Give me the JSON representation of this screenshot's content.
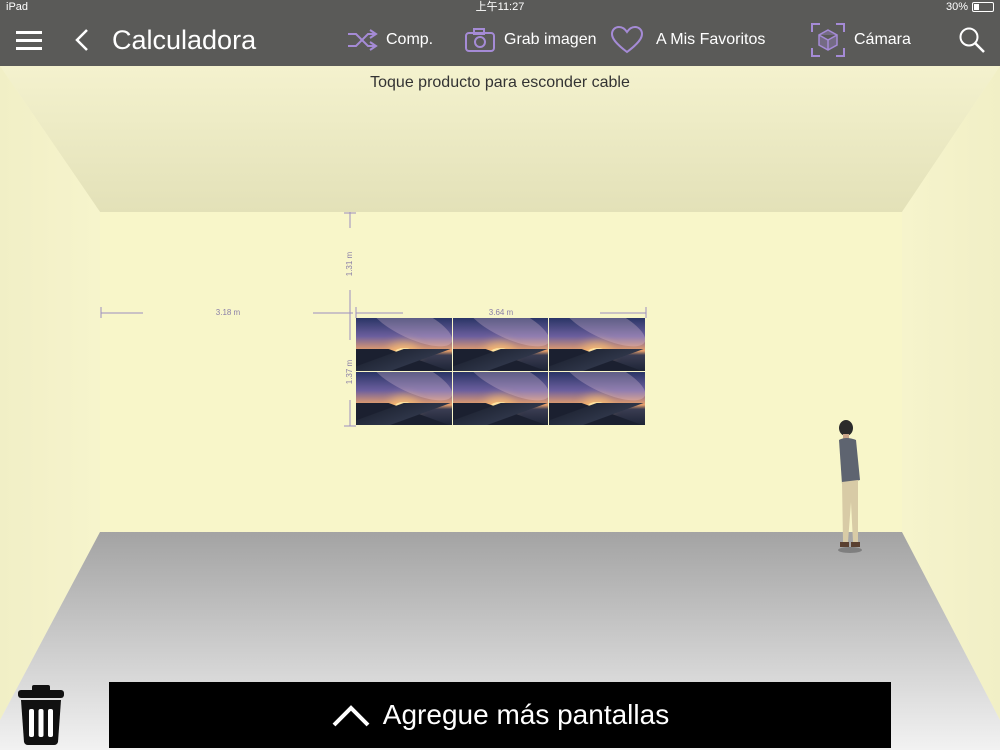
{
  "status_bar": {
    "device": "iPad",
    "time": "上午11:27",
    "battery": "30%",
    "battery_level": 0.3
  },
  "nav": {
    "title": "Calculadora",
    "actions": {
      "compare": "Comp.",
      "screenshot": "Grab imagen",
      "favorites": "A Mis Favoritos",
      "camera": "Cámara"
    },
    "icons": [
      "menu-icon",
      "back-chevron-icon",
      "shuffle-icon",
      "camera-icon",
      "heart-icon",
      "ar-cube-icon",
      "search-icon"
    ]
  },
  "hint": "Toque producto para esconder cable",
  "dimensions": {
    "left_distance": "3.18 m",
    "top_distance": "1.31 m",
    "width": "3.64 m",
    "height": "1.37 m"
  },
  "video_wall": {
    "rows": 2,
    "columns": 3
  },
  "bottom_bar": {
    "label": "Agregue más pantallas"
  },
  "colors": {
    "nav_background": "#5a5a58",
    "accent": "#a58bd6",
    "wall": "#f7f5cf",
    "floor": "#a9a9a9",
    "bottom_bar": "#000000"
  }
}
